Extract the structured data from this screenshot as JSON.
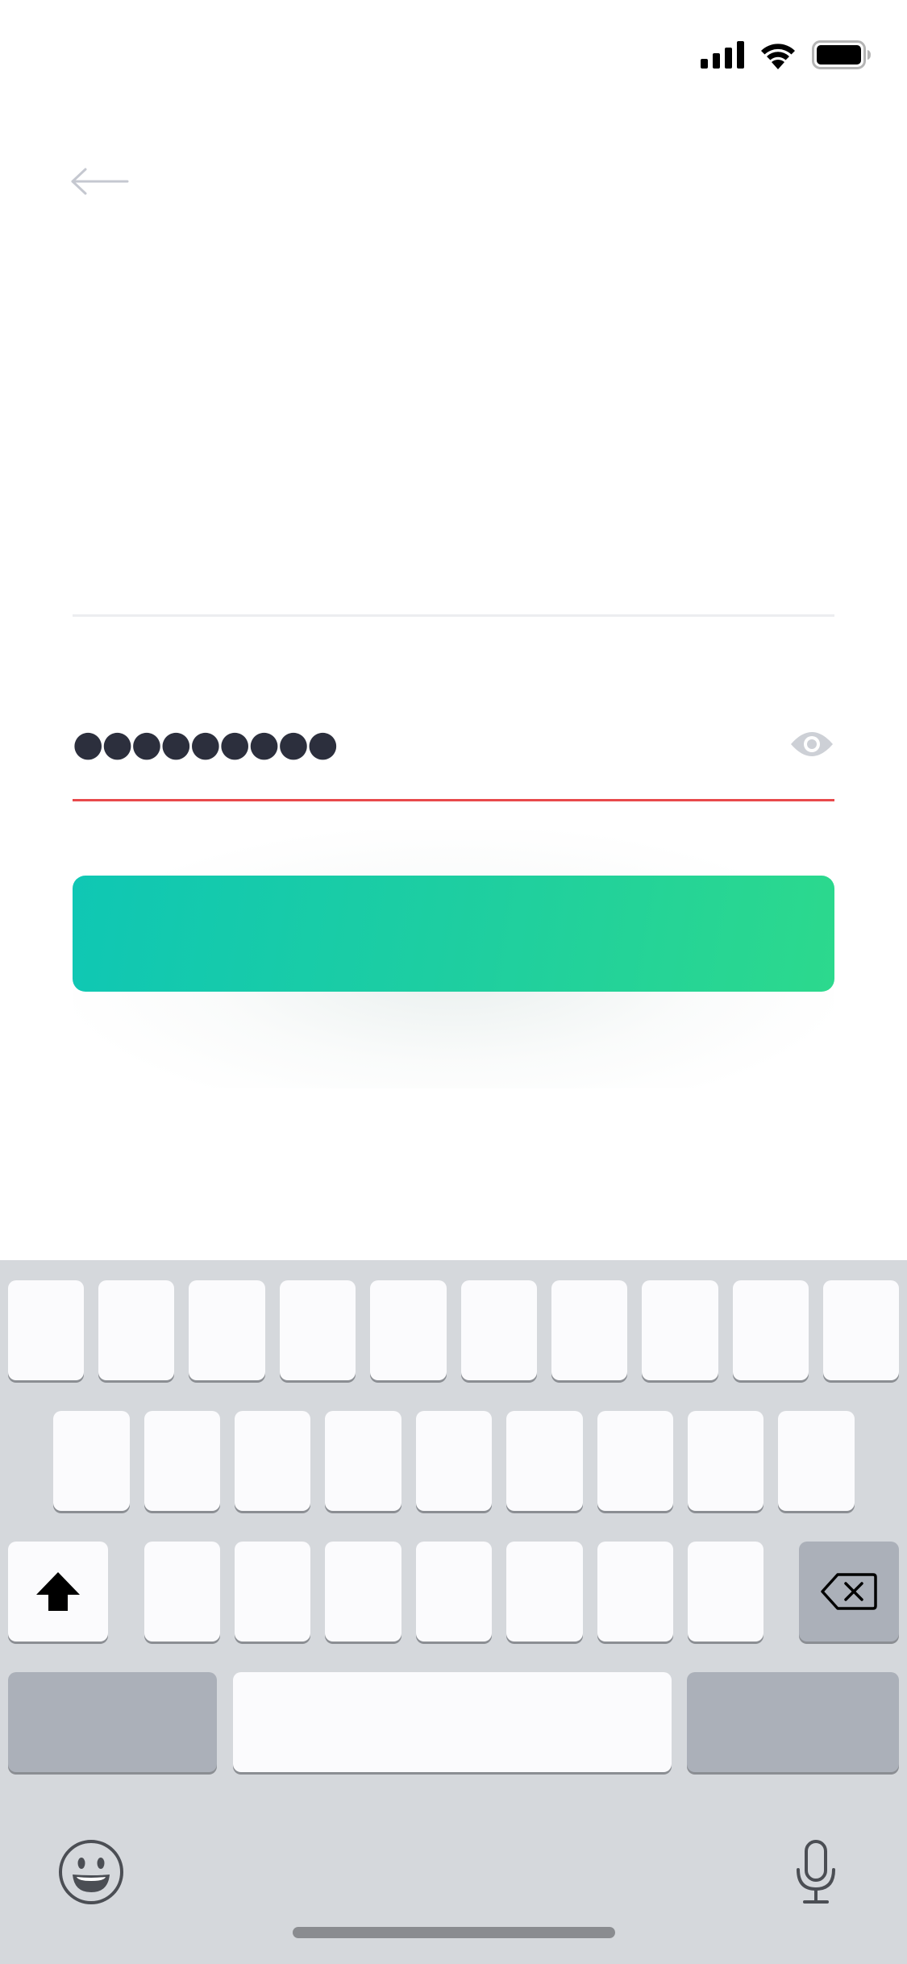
{
  "status_bar": {
    "signal_icon": "cellular-signal-icon",
    "wifi_icon": "wifi-icon",
    "battery_icon": "battery-icon",
    "battery_level": 1.0
  },
  "nav": {
    "back_icon": "arrow-left-icon"
  },
  "form": {
    "username_value": "",
    "password_value": "●●●●●●●●●",
    "password_visibility_icon": "eye-icon",
    "password_error_color": "#e8494b",
    "submit_label": ""
  },
  "colors": {
    "button_gradient_start": "#0fc7b4",
    "button_gradient_end": "#2cd98d",
    "text_primary": "#2c2f3d",
    "keyboard_bg": "#d5d8dc"
  },
  "keyboard": {
    "row1_keys": [
      "",
      "",
      "",
      "",
      "",
      "",
      "",
      "",
      "",
      ""
    ],
    "row2_keys": [
      "",
      "",
      "",
      "",
      "",
      "",
      "",
      "",
      ""
    ],
    "row3_keys": [
      "",
      "",
      "",
      "",
      "",
      "",
      ""
    ],
    "shift_icon": "shift-arrow-icon",
    "delete_icon": "backspace-icon",
    "numbers_label": "",
    "space_label": "",
    "return_label": "",
    "emoji_icon": "emoji-icon",
    "mic_icon": "microphone-icon"
  }
}
